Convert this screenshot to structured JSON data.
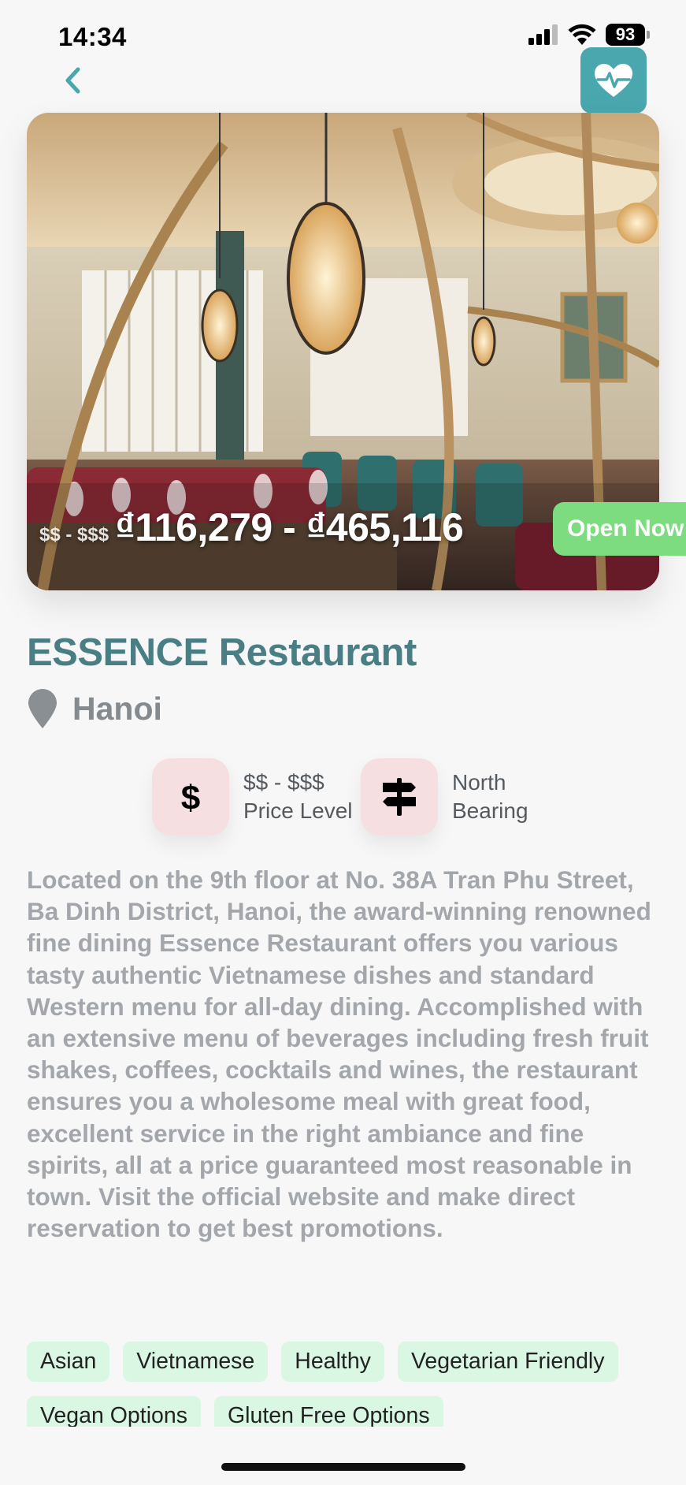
{
  "status_bar": {
    "time": "14:34",
    "battery": "93",
    "icons": [
      "cellular-signal-icon",
      "wifi-icon",
      "battery-icon"
    ]
  },
  "nav": {
    "back_icon": "chevron-left-icon",
    "health_icon": "heart-pulse-icon"
  },
  "hero": {
    "price_level": "$$ - $$$",
    "price_range": "₫116,279 - ₫465,116",
    "status": "Open Now"
  },
  "restaurant": {
    "name": "ESSENCE Restaurant",
    "location": "Hanoi",
    "location_icon": "map-pin-icon"
  },
  "info": {
    "price": {
      "icon": "dollar-icon",
      "value": "$$ - $$$",
      "label": "Price Level"
    },
    "bearing": {
      "icon": "signpost-icon",
      "value": "North",
      "label": "Bearing"
    }
  },
  "description": "Located on the 9th floor at No. 38A Tran Phu Street, Ba Dinh District, Hanoi, the award-winning renowned fine dining Essence Restaurant offers you various tasty authentic Vietnamese dishes and standard Western menu for all-day dining. Accomplished with an extensive menu of beverages including fresh fruit shakes, coffees, cocktails and wines, the restaurant ensures you a wholesome meal with great food, excellent service in the right ambiance and fine spirits, all at a price guaranteed most reasonable in town. Visit the official website and make direct reservation to get best promotions.",
  "tags": [
    "Asian",
    "Vietnamese",
    "Healthy",
    "Vegetarian Friendly",
    "Vegan Options",
    "Gluten Free Options"
  ],
  "colors": {
    "accent": "#4aa7ae",
    "title": "#4a7e85",
    "open_badge": "#7ddc7f",
    "tag_bg": "#d9f7e3",
    "info_icon_bg": "#f6dfe0"
  }
}
